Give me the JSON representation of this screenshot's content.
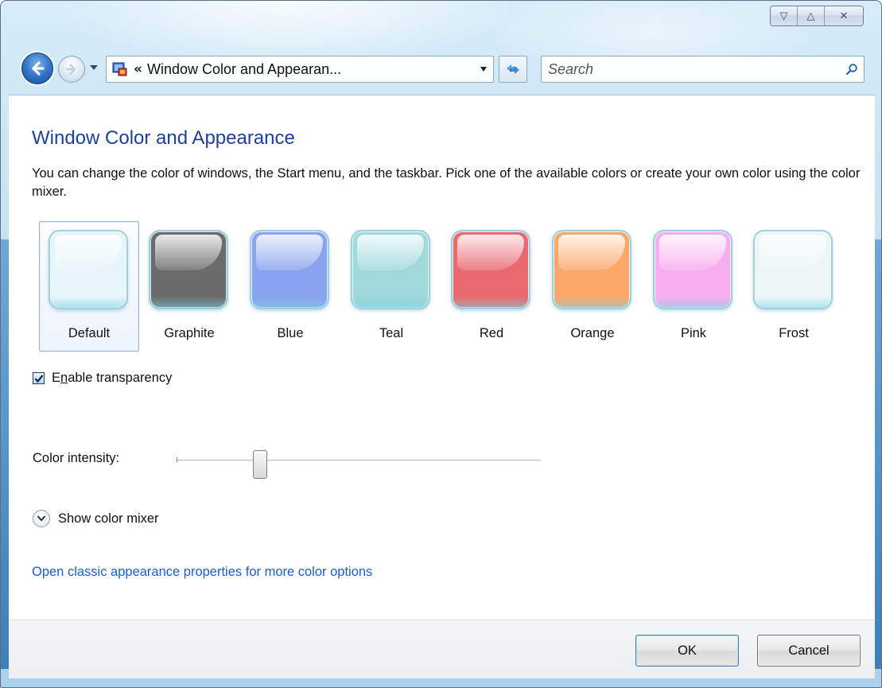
{
  "window": {
    "caption_buttons": [
      {
        "name": "minimize",
        "glyph": "▽"
      },
      {
        "name": "maximize",
        "glyph": "△"
      },
      {
        "name": "close",
        "glyph": "✕"
      }
    ]
  },
  "navigation": {
    "address_chevron": "«",
    "address_text": "Window Color and Appearan...",
    "search_placeholder": "Search"
  },
  "page": {
    "title": "Window Color and Appearance",
    "description": "You can change the color of windows, the Start menu, and the taskbar. Pick one of the available colors or create your own color using the color mixer.",
    "swatches": [
      {
        "label": "Default",
        "color": "#e6f5fb",
        "selected": true
      },
      {
        "label": "Graphite",
        "color": "#6b6b6b",
        "selected": false
      },
      {
        "label": "Blue",
        "color": "#8aa3ee",
        "selected": false
      },
      {
        "label": "Teal",
        "color": "#9fd9dc",
        "selected": false
      },
      {
        "label": "Red",
        "color": "#e86a70",
        "selected": false
      },
      {
        "label": "Orange",
        "color": "#fba86a",
        "selected": false
      },
      {
        "label": "Pink",
        "color": "#f7aef0",
        "selected": false
      },
      {
        "label": "Frost",
        "color": "#ecf6f6",
        "selected": false
      }
    ],
    "transparency_label_pre": "E",
    "transparency_label_u": "n",
    "transparency_label_post": "able transparency",
    "transparency_checked": true,
    "intensity_label": "Color intensity:",
    "intensity_value_fraction": 0.23,
    "mixer_label": "Show color mixer",
    "classic_link": "Open classic appearance properties for more color options"
  },
  "footer": {
    "ok_label": "OK",
    "cancel_label": "Cancel"
  }
}
